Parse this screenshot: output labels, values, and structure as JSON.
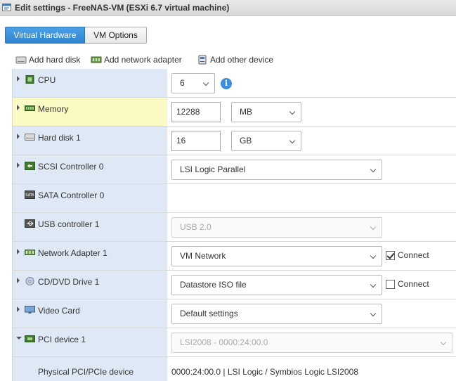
{
  "window": {
    "title": "Edit settings - FreeNAS-VM (ESXi 6.7 virtual machine)"
  },
  "tabs": [
    {
      "label": "Virtual Hardware",
      "active": true
    },
    {
      "label": "VM Options",
      "active": false
    }
  ],
  "toolbar": {
    "add_hard_disk": "Add hard disk",
    "add_network_adapter": "Add network adapter",
    "add_other_device": "Add other device"
  },
  "devices": {
    "cpu": {
      "label": "CPU",
      "value": "6"
    },
    "memory": {
      "label": "Memory",
      "value": "12288",
      "unit": "MB"
    },
    "hard_disk": {
      "label": "Hard disk 1",
      "value": "16",
      "unit": "GB"
    },
    "scsi": {
      "label": "SCSI Controller 0",
      "value": "LSI Logic Parallel"
    },
    "sata": {
      "label": "SATA Controller 0"
    },
    "usb": {
      "label": "USB controller 1",
      "value": "USB 2.0"
    },
    "network": {
      "label": "Network Adapter 1",
      "value": "VM Network",
      "connect_label": "Connect",
      "connected": true
    },
    "cddvd": {
      "label": "CD/DVD Drive 1",
      "value": "Datastore ISO file",
      "connect_label": "Connect",
      "connected": false
    },
    "video": {
      "label": "Video Card",
      "value": "Default settings"
    },
    "pci": {
      "label": "PCI device 1",
      "value": "LSI2008 - 0000:24:00.0"
    },
    "pci_physical": {
      "label": "Physical PCI/PCIe device",
      "value": "0000:24:00.0 | LSI Logic / Symbios Logic LSI2008"
    }
  },
  "colors": {
    "accent": "#2e84cf",
    "row_label_bg": "#dfe9f5",
    "highlight_bg": "#fcfac4"
  }
}
